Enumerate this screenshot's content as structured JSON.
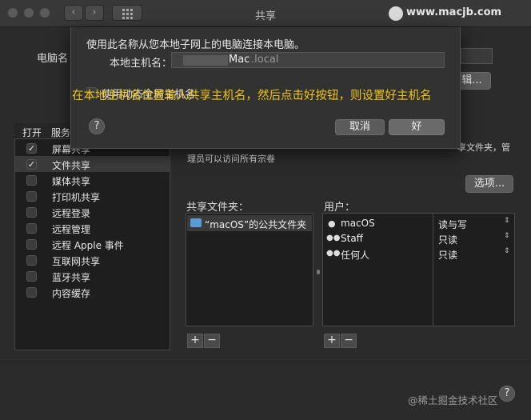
{
  "window": {
    "title": "共享"
  },
  "watermarks": {
    "top": "www.macjb.com",
    "bottom": "@稀土掘金技术社区"
  },
  "background": {
    "computer_name_label": "电脑名",
    "edit_button": "辑...",
    "service_desc_1": "享文件夹，管",
    "service_desc_2": "理员可以访问所有宗卷",
    "options_button": "选项..."
  },
  "services": {
    "header_on": "打开",
    "header_service": "服务",
    "items": [
      {
        "label": "屏幕共享",
        "checked": true,
        "selected": false
      },
      {
        "label": "文件共享",
        "checked": true,
        "selected": true
      },
      {
        "label": "媒体共享",
        "checked": false,
        "selected": false
      },
      {
        "label": "打印机共享",
        "checked": false,
        "selected": false
      },
      {
        "label": "远程登录",
        "checked": false,
        "selected": false
      },
      {
        "label": "远程管理",
        "checked": false,
        "selected": false
      },
      {
        "label": "远程 Apple 事件",
        "checked": false,
        "selected": false
      },
      {
        "label": "互联网共享",
        "checked": false,
        "selected": false
      },
      {
        "label": "蓝牙共享",
        "checked": false,
        "selected": false
      },
      {
        "label": "内容缓存",
        "checked": false,
        "selected": false
      }
    ]
  },
  "shared_folders": {
    "label": "共享文件夹：",
    "items": [
      "“macOS”的公共文件夹"
    ],
    "add": "+",
    "remove": "−"
  },
  "users": {
    "label": "用户：",
    "items": [
      {
        "name": "macOS",
        "permission": "读与写"
      },
      {
        "name": "Staff",
        "permission": "只读"
      },
      {
        "name": "任何人",
        "permission": "只读"
      }
    ],
    "add": "+",
    "remove": "−"
  },
  "dialog": {
    "message": "使用此名称从您本地子网上的电脑连接本电脑。",
    "hostname_label": "本地主机名：",
    "hostname_value": "Mac",
    "hostname_suffix": ".local",
    "dynamic_checkbox_label": "使用动态全局主机名",
    "cancel_button": "取消",
    "ok_button": "好"
  },
  "annotation": "在本地主机名位置输入共享主机名，然后点击好按钮，则设置好主机名",
  "help": "?",
  "colors": {
    "annotation": "#f0c419",
    "window_bg": "#2b2b2b",
    "selection": "#3a3a3a"
  }
}
